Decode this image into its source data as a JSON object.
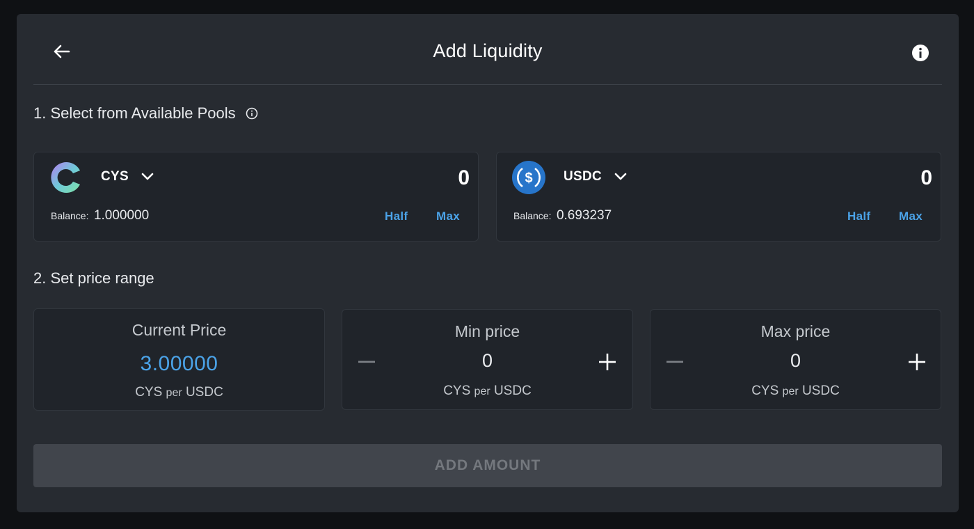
{
  "header": {
    "title": "Add Liquidity"
  },
  "step1": {
    "title": "1. Select from Available Pools"
  },
  "tokens": [
    {
      "symbol": "CYS",
      "amount": "0",
      "balance_label": "Balance:",
      "balance_value": "1.000000",
      "half_label": "Half",
      "max_label": "Max",
      "icon": "cys-logo-icon"
    },
    {
      "symbol": "USDC",
      "amount": "0",
      "balance_label": "Balance:",
      "balance_value": "0.693237",
      "half_label": "Half",
      "max_label": "Max",
      "icon": "usdc-logo-icon"
    }
  ],
  "step2": {
    "title": "2. Set price range"
  },
  "current_price": {
    "label": "Current Price",
    "value": "3.00000",
    "unit_base": "CYS",
    "unit_per": "per",
    "unit_quote": "USDC"
  },
  "min_price": {
    "label": "Min price",
    "value": "0",
    "unit_base": "CYS",
    "unit_per": "per",
    "unit_quote": "USDC"
  },
  "max_price": {
    "label": "Max price",
    "value": "0",
    "unit_base": "CYS",
    "unit_per": "per",
    "unit_quote": "USDC"
  },
  "actions": {
    "add_amount_label": "ADD AMOUNT"
  },
  "colors": {
    "accent": "#4ba3e8",
    "panel": "#272b31",
    "card": "#20242a",
    "usdc": "#2775ca"
  }
}
